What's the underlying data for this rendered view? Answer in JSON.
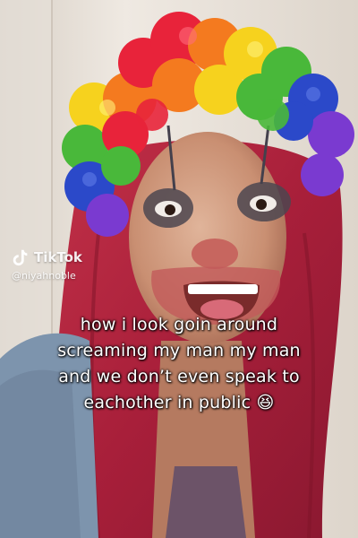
{
  "video": {
    "caption_lines": [
      "how i look goin around",
      "screaming my man my man",
      "and we don’t even speak to",
      "eachother in public 😆"
    ]
  },
  "watermark": {
    "brand": "TikTok",
    "handle": "@niyahnoble",
    "logo_icon": "tiktok-logo-icon"
  },
  "colors": {
    "hair": "#b3243f",
    "wig_red": "#e8233a",
    "wig_orange": "#f47a1f",
    "wig_yellow": "#f6d21e",
    "wig_green": "#49b83a",
    "wig_blue": "#2b49c9",
    "wig_purple": "#7a3ad0",
    "jacket": "#7d94ad"
  }
}
